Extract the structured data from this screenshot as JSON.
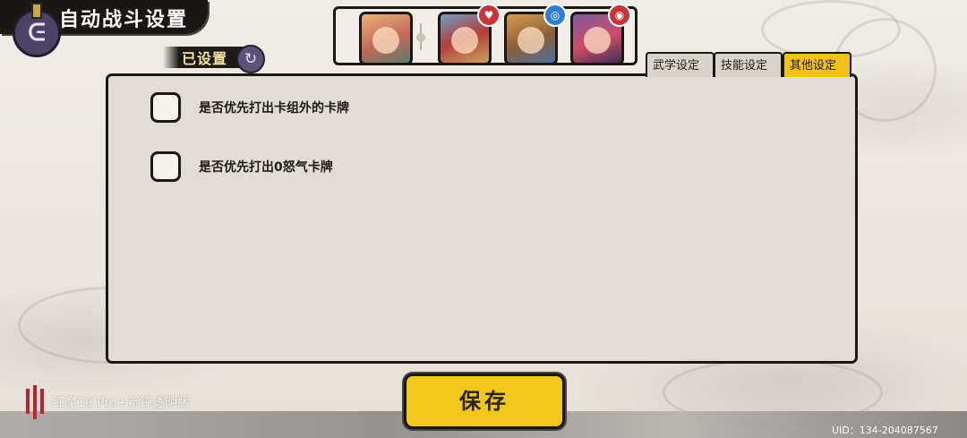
{
  "header": {
    "title": "自动战斗设置",
    "back_icon": "back-arrow-icon",
    "status": {
      "label": "已设置",
      "icon": "swap-icon"
    }
  },
  "team": {
    "portraits": [
      {
        "name": "portrait-1",
        "badge": ""
      },
      {
        "name": "portrait-2",
        "badge": "♥",
        "badge_color": "#c9343b"
      },
      {
        "name": "portrait-3",
        "badge": "◎",
        "badge_color": "#2f7ed1"
      },
      {
        "name": "portrait-4",
        "badge": "◉",
        "badge_color": "#c9343b"
      }
    ]
  },
  "tabs": [
    {
      "label": "武学设定",
      "active": false
    },
    {
      "label": "技能设定",
      "active": false
    },
    {
      "label": "其他设定",
      "active": true
    }
  ],
  "options": [
    {
      "label": "是否优先打出卡组外的卡牌",
      "checked": false
    },
    {
      "label": "是否优先打出0怒气卡牌",
      "checked": false
    }
  ],
  "save_label": "保存",
  "watermark": "红魔10 Pro+氘锋透明版",
  "uid": "UID：134-204087567",
  "colors": {
    "accent": "#f2c71c",
    "panel": "#e1dcd5",
    "ink": "#1a1714"
  }
}
